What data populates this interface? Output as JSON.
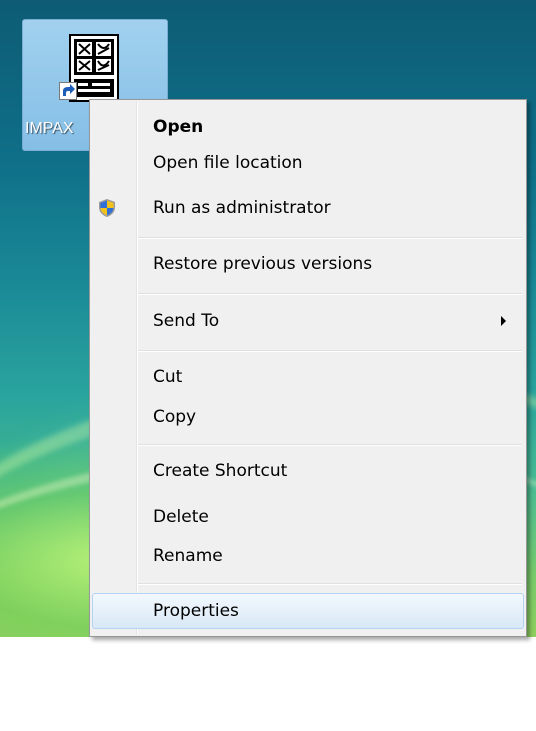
{
  "desktop_icon": {
    "label": "IMPAX",
    "icon": "impax-app-icon",
    "overlay_icon": "shortcut-arrow-icon"
  },
  "context_menu": {
    "items": [
      {
        "label": "Open",
        "default": true
      },
      {
        "label": "Open file location"
      },
      {
        "label": "Run as administrator",
        "icon": "uac-shield-icon"
      },
      {
        "label": "Restore previous versions"
      },
      {
        "label": "Send To",
        "submenu": true
      },
      {
        "label": "Cut"
      },
      {
        "label": "Copy"
      },
      {
        "label": "Create Shortcut"
      },
      {
        "label": "Delete"
      },
      {
        "label": "Rename"
      },
      {
        "label": "Properties",
        "highlighted": true
      }
    ]
  },
  "colors": {
    "menu_background": "#f0f0f0",
    "menu_border": "#979797",
    "highlight_border": "#b3d3f0",
    "icon_selection": "#a9d2f2"
  }
}
